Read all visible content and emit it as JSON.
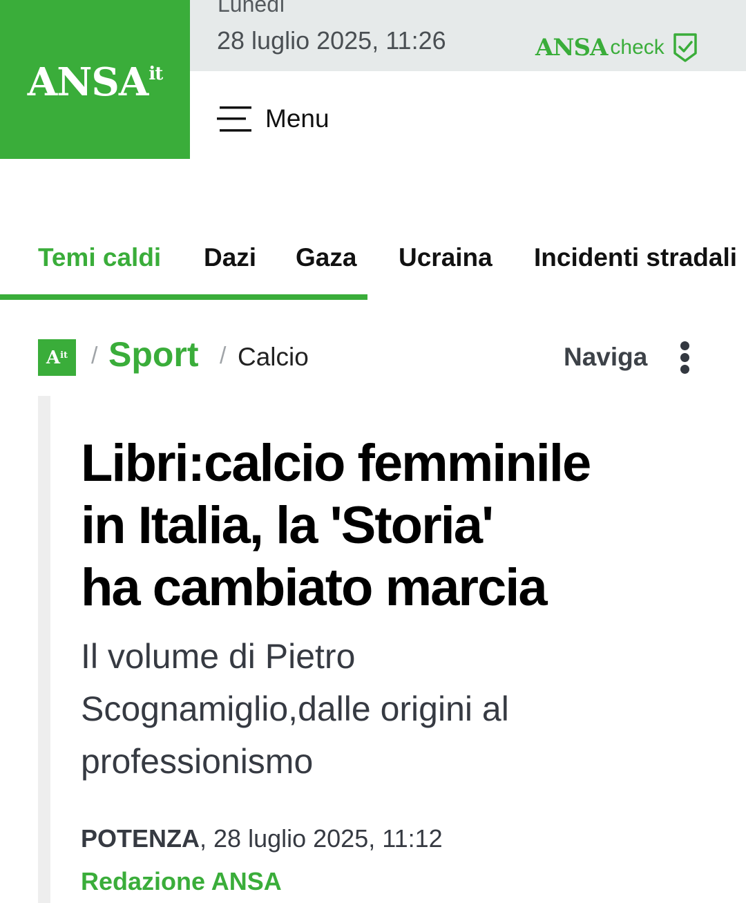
{
  "header": {
    "logo_main": "ANSA",
    "logo_suffix": "it",
    "date_day": "Lunedì",
    "date_full": "28 luglio 2025, 11:26",
    "ansa_check_brand": "ANSA",
    "ansa_check_label": "check",
    "menu_label": "Menu"
  },
  "topics": {
    "items": [
      "Temi caldi",
      "Dazi",
      "Gaza",
      "Ucraina",
      "Incidenti stradali"
    ],
    "active_index": 0
  },
  "breadcrumb": {
    "home_badge_main": "A",
    "home_badge_suffix": "it",
    "separator": "/",
    "section": "Sport",
    "subsection": "Calcio",
    "navigate_label": "Naviga"
  },
  "article": {
    "headline_lines": [
      "Libri:calcio femminile",
      "in Italia, la 'Storia'",
      "ha cambiato marcia"
    ],
    "subhead_lines": [
      "Il volume di Pietro",
      "Scognamiglio,dalle origini al",
      "professionismo"
    ],
    "dateline_city": "POTENZA",
    "dateline_rest": ", 28 luglio 2025, 11:12",
    "byline": "Redazione ANSA"
  },
  "colors": {
    "brand_green": "#3aad3a",
    "date_bar_bg": "#e6eaea",
    "text_dark": "#000000",
    "text_muted": "#363a42"
  },
  "icons": {
    "menu": "hamburger-icon",
    "check": "shield-check-icon",
    "more": "kebab-icon"
  }
}
